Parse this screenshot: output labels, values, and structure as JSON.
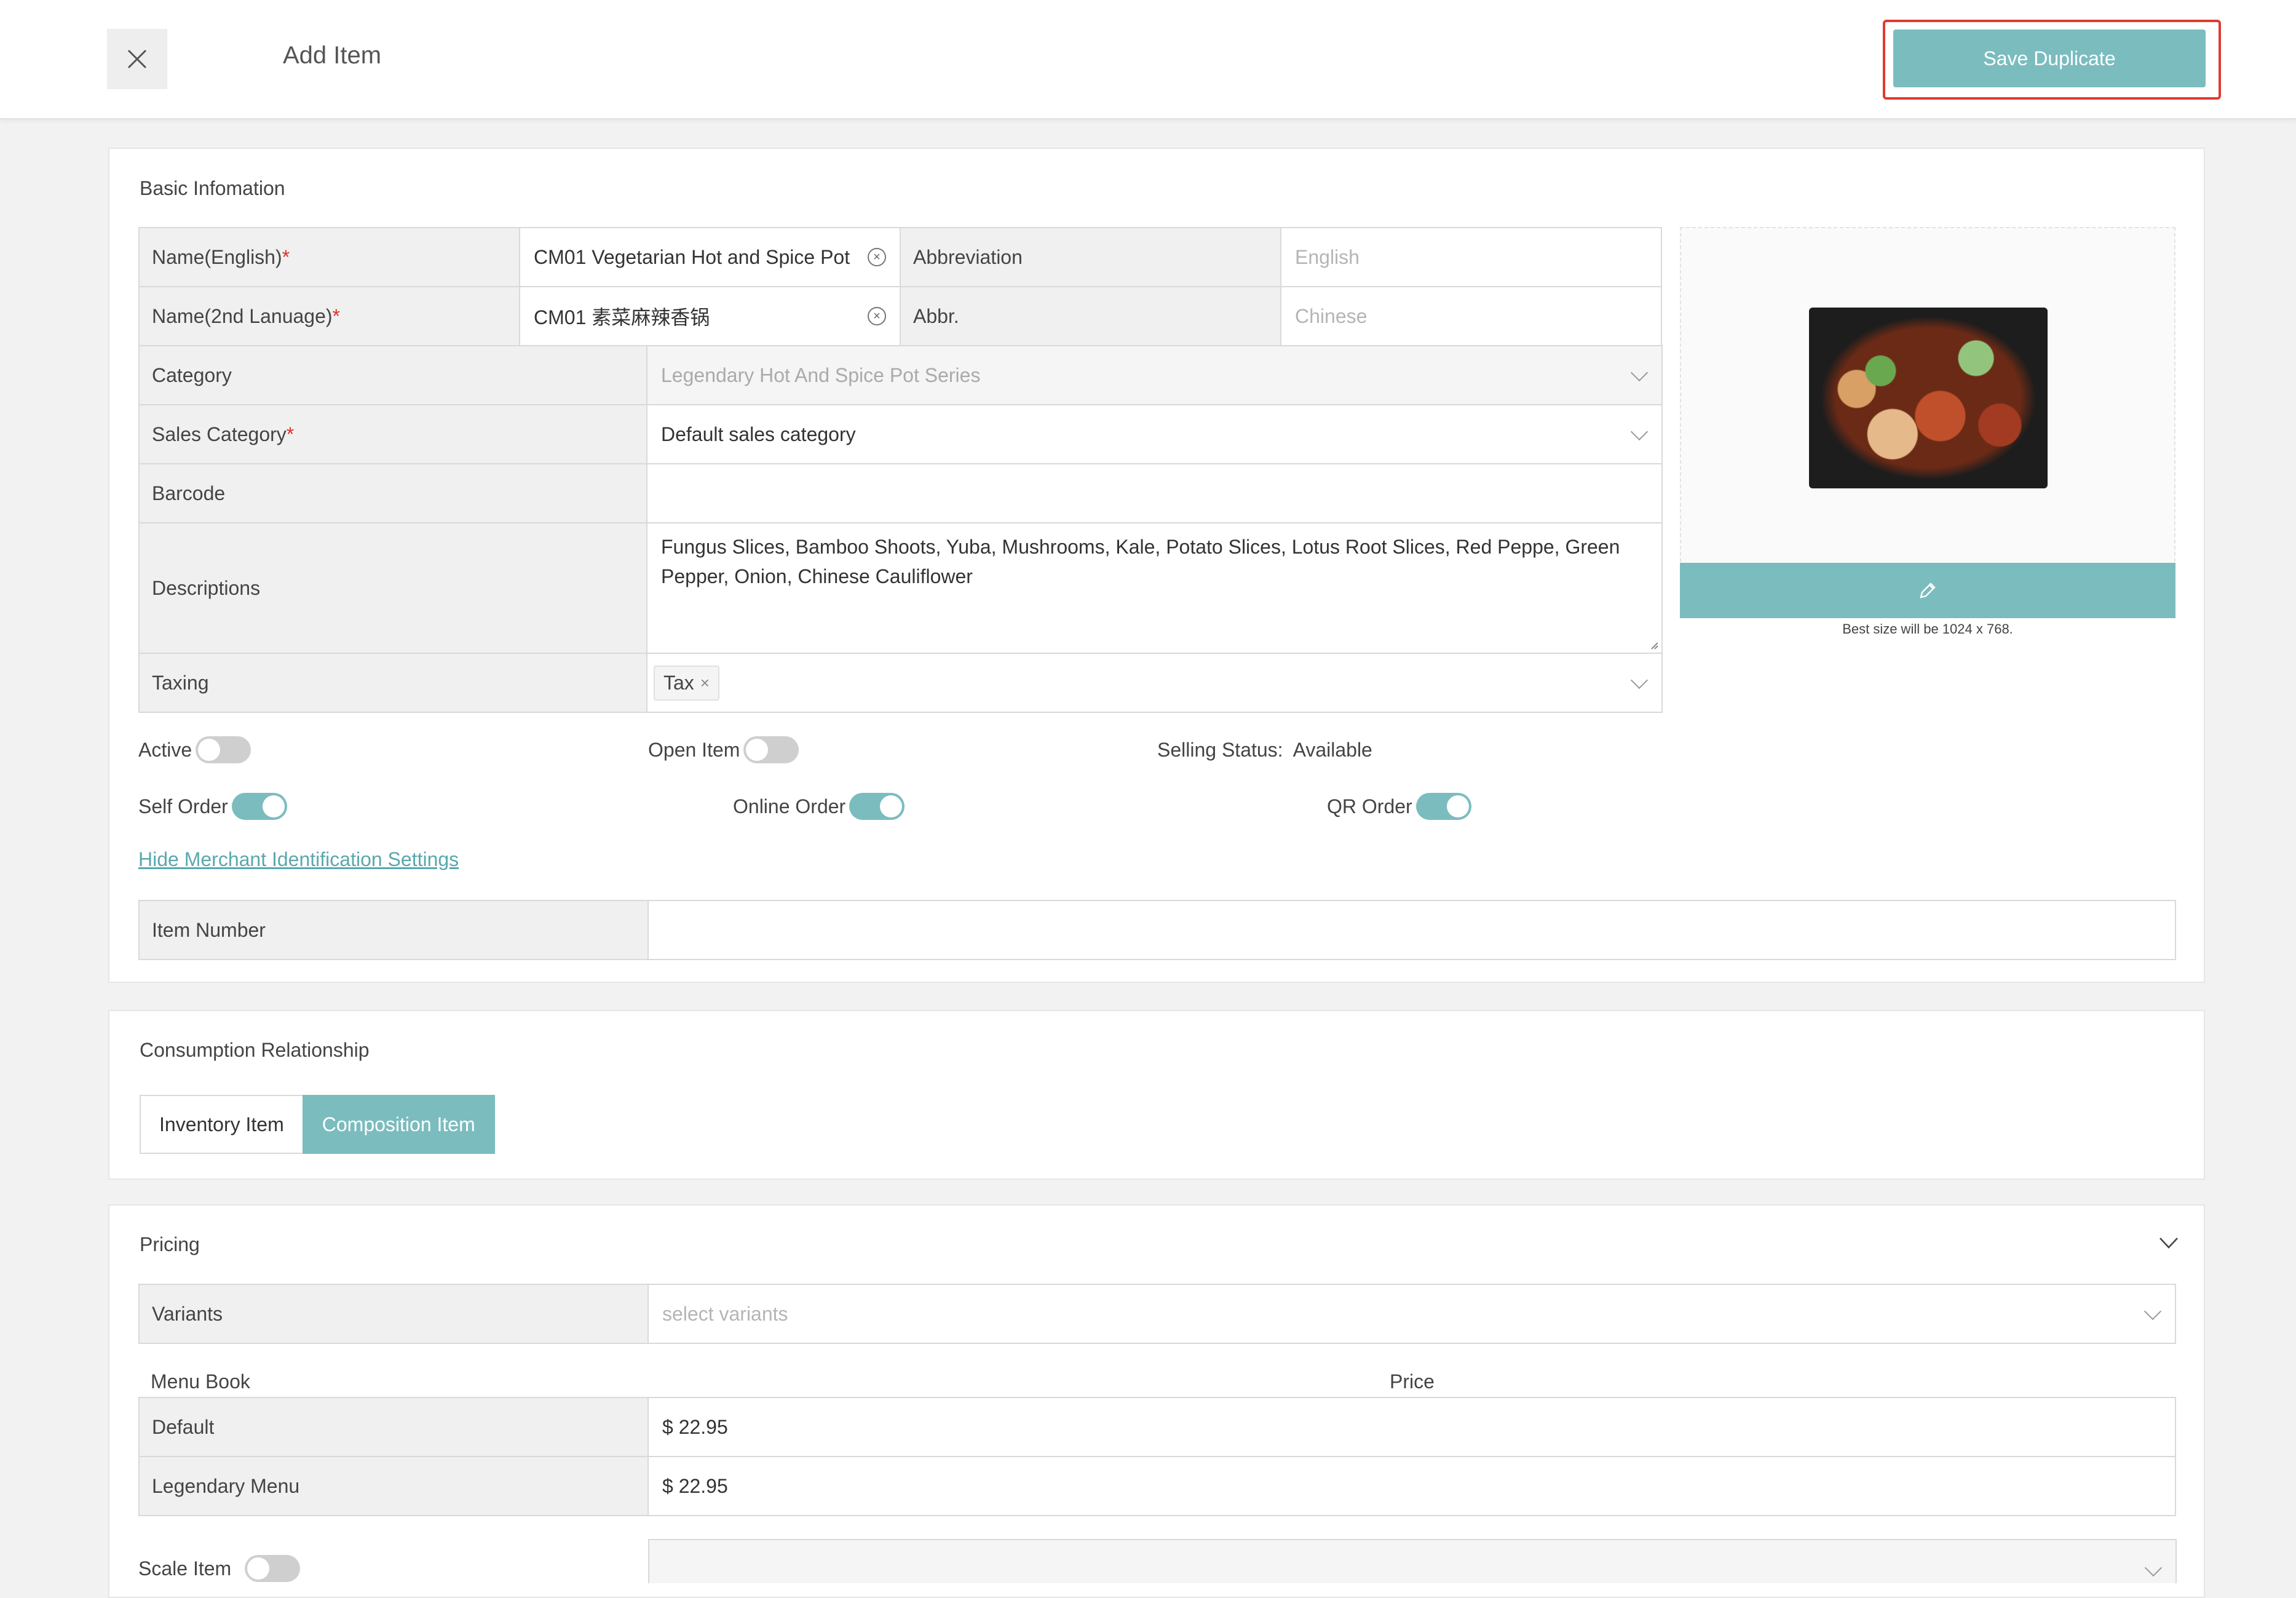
{
  "header": {
    "title": "Add Item",
    "save_label": "Save Duplicate"
  },
  "basic": {
    "section_title": "Basic Infomation",
    "name_en_label": "Name(English)",
    "name_en_value": "CM01 Vegetarian Hot and Spice Pot",
    "abbr_label": "Abbreviation",
    "abbr_en_placeholder": "English",
    "name_2nd_label": "Name(2nd Lanuage)",
    "name_2nd_value": "CM01 素菜麻辣香锅",
    "abbr2_label": "Abbr.",
    "abbr_cn_placeholder": "Chinese",
    "category_label": "Category",
    "category_value": "Legendary Hot And Spice Pot Series",
    "sales_category_label": "Sales Category",
    "sales_category_value": "Default sales category",
    "barcode_label": "Barcode",
    "barcode_value": "",
    "descriptions_label": "Descriptions",
    "descriptions_value": "Fungus Slices, Bamboo Shoots, Yuba, Mushrooms, Kale, Potato Slices, Lotus Root Slices, Red Peppe, Green Pepper, Onion, Chinese Cauliflower",
    "taxing_label": "Taxing",
    "tax_tag": "Tax",
    "required_mark": "*",
    "image_note": "Best size will be 1024 x 768."
  },
  "toggles": {
    "active_label": "Active",
    "active_on": false,
    "open_item_label": "Open Item",
    "open_item_on": false,
    "selling_status_label": "Selling Status:",
    "selling_status_value": "Available",
    "self_order_label": "Self Order",
    "self_order_on": true,
    "online_order_label": "Online Order",
    "online_order_on": true,
    "qr_order_label": "QR Order",
    "qr_order_on": true
  },
  "merchant": {
    "link_label": "Hide Merchant Identification Settings",
    "item_number_label": "Item Number",
    "item_number_value": ""
  },
  "consumption": {
    "section_title": "Consumption Relationship",
    "options": [
      "Inventory Item",
      "Composition Item"
    ],
    "selected": "Composition Item"
  },
  "pricing": {
    "section_title": "Pricing",
    "variants_label": "Variants",
    "variants_placeholder": "select variants",
    "menu_book_header": "Menu Book",
    "price_header": "Price",
    "rows": [
      {
        "menu": "Default",
        "price": "$ 22.95"
      },
      {
        "menu": "Legendary Menu",
        "price": "$ 22.95"
      }
    ],
    "scale_item_label": "Scale Item",
    "scale_item_on": false
  },
  "colors": {
    "accent": "#7bbcbf",
    "highlight_border": "#e03b2f",
    "required": "#e0302a"
  }
}
